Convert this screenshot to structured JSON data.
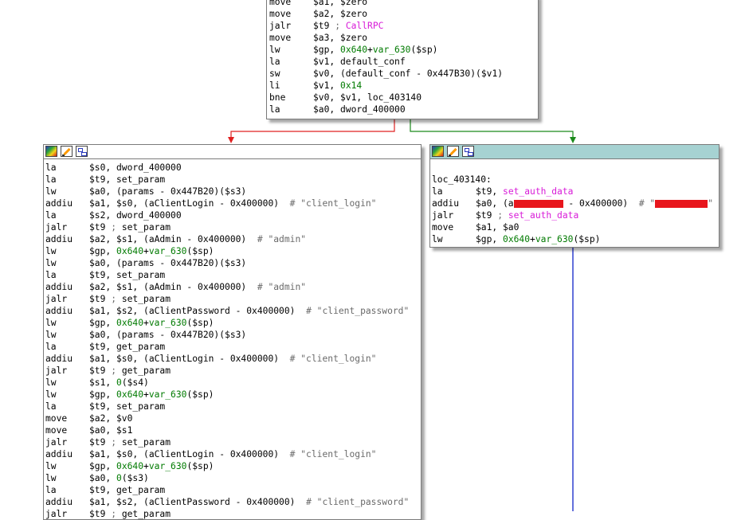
{
  "top_block": {
    "lines": [
      {
        "mn": "move",
        "ops": [
          {
            "t": "$a1, $zero"
          }
        ]
      },
      {
        "mn": "move",
        "ops": [
          {
            "t": "$a2, $zero"
          }
        ]
      },
      {
        "mn": "jalr",
        "ops": [
          {
            "t": "$t9 "
          },
          {
            "t": "; ",
            "c": "gray"
          },
          {
            "t": "CallRPC",
            "c": "pink"
          }
        ]
      },
      {
        "mn": "move",
        "ops": [
          {
            "t": "$a3, $zero"
          }
        ]
      },
      {
        "mn": "lw",
        "ops": [
          {
            "t": "$gp, "
          },
          {
            "t": "0x640",
            "c": "green"
          },
          {
            "t": "+"
          },
          {
            "t": "var_630",
            "c": "green"
          },
          {
            "t": "($sp)"
          }
        ]
      },
      {
        "mn": "la",
        "ops": [
          {
            "t": "$v1, default_conf"
          }
        ]
      },
      {
        "mn": "sw",
        "ops": [
          {
            "t": "$v0, (default_conf - 0x447B30)($v1)"
          }
        ]
      },
      {
        "mn": "li",
        "ops": [
          {
            "t": "$v1, "
          },
          {
            "t": "0x14",
            "c": "green"
          }
        ]
      },
      {
        "mn": "bne",
        "ops": [
          {
            "t": "$v0, $v1, loc_403140"
          }
        ]
      },
      {
        "mn": "la",
        "ops": [
          {
            "t": "$a0, dword_400000"
          }
        ]
      }
    ]
  },
  "left_block": {
    "lines": [
      {
        "mn": "la",
        "ops": [
          {
            "t": "$s0, dword_400000"
          }
        ]
      },
      {
        "mn": "la",
        "ops": [
          {
            "t": "$t9, set_param"
          }
        ]
      },
      {
        "mn": "lw",
        "ops": [
          {
            "t": "$a0, (params - 0x447B20)($s3)"
          }
        ]
      },
      {
        "mn": "addiu",
        "ops": [
          {
            "t": "$a1, $s0, (aClientLogin - 0x400000)  "
          },
          {
            "t": "# \"client_login\"",
            "c": "gray"
          }
        ]
      },
      {
        "mn": "la",
        "ops": [
          {
            "t": "$s2, dword_400000"
          }
        ]
      },
      {
        "mn": "jalr",
        "ops": [
          {
            "t": "$t9 "
          },
          {
            "t": "; ",
            "c": "gray"
          },
          {
            "t": "set_param"
          }
        ]
      },
      {
        "mn": "addiu",
        "ops": [
          {
            "t": "$a2, $s1, (aAdmin - 0x400000)  "
          },
          {
            "t": "# \"admin\"",
            "c": "gray"
          }
        ]
      },
      {
        "mn": "lw",
        "ops": [
          {
            "t": "$gp, "
          },
          {
            "t": "0x640",
            "c": "green"
          },
          {
            "t": "+"
          },
          {
            "t": "var_630",
            "c": "green"
          },
          {
            "t": "($sp)"
          }
        ]
      },
      {
        "mn": "lw",
        "ops": [
          {
            "t": "$a0, (params - 0x447B20)($s3)"
          }
        ]
      },
      {
        "mn": "la",
        "ops": [
          {
            "t": "$t9, set_param"
          }
        ]
      },
      {
        "mn": "addiu",
        "ops": [
          {
            "t": "$a2, $s1, (aAdmin - 0x400000)  "
          },
          {
            "t": "# \"admin\"",
            "c": "gray"
          }
        ]
      },
      {
        "mn": "jalr",
        "ops": [
          {
            "t": "$t9 "
          },
          {
            "t": "; ",
            "c": "gray"
          },
          {
            "t": "set_param"
          }
        ]
      },
      {
        "mn": "addiu",
        "ops": [
          {
            "t": "$a1, $s2, (aClientPassword - 0x400000)  "
          },
          {
            "t": "# \"client_password\"",
            "c": "gray"
          }
        ]
      },
      {
        "mn": "lw",
        "ops": [
          {
            "t": "$gp, "
          },
          {
            "t": "0x640",
            "c": "green"
          },
          {
            "t": "+"
          },
          {
            "t": "var_630",
            "c": "green"
          },
          {
            "t": "($sp)"
          }
        ]
      },
      {
        "mn": "lw",
        "ops": [
          {
            "t": "$a0, (params - 0x447B20)($s3)"
          }
        ]
      },
      {
        "mn": "la",
        "ops": [
          {
            "t": "$t9, get_param"
          }
        ]
      },
      {
        "mn": "addiu",
        "ops": [
          {
            "t": "$a1, $s0, (aClientLogin - 0x400000)  "
          },
          {
            "t": "# \"client_login\"",
            "c": "gray"
          }
        ]
      },
      {
        "mn": "jalr",
        "ops": [
          {
            "t": "$t9 "
          },
          {
            "t": "; ",
            "c": "gray"
          },
          {
            "t": "get_param"
          }
        ]
      },
      {
        "mn": "lw",
        "ops": [
          {
            "t": "$s1, "
          },
          {
            "t": "0",
            "c": "green"
          },
          {
            "t": "($s4)"
          }
        ]
      },
      {
        "mn": "lw",
        "ops": [
          {
            "t": "$gp, "
          },
          {
            "t": "0x640",
            "c": "green"
          },
          {
            "t": "+"
          },
          {
            "t": "var_630",
            "c": "green"
          },
          {
            "t": "($sp)"
          }
        ]
      },
      {
        "mn": "la",
        "ops": [
          {
            "t": "$t9, set_param"
          }
        ]
      },
      {
        "mn": "move",
        "ops": [
          {
            "t": "$a2, $v0"
          }
        ]
      },
      {
        "mn": "move",
        "ops": [
          {
            "t": "$a0, $s1"
          }
        ]
      },
      {
        "mn": "jalr",
        "ops": [
          {
            "t": "$t9 "
          },
          {
            "t": "; ",
            "c": "gray"
          },
          {
            "t": "set_param"
          }
        ]
      },
      {
        "mn": "addiu",
        "ops": [
          {
            "t": "$a1, $s0, (aClientLogin - 0x400000)  "
          },
          {
            "t": "# \"client_login\"",
            "c": "gray"
          }
        ]
      },
      {
        "mn": "lw",
        "ops": [
          {
            "t": "$gp, "
          },
          {
            "t": "0x640",
            "c": "green"
          },
          {
            "t": "+"
          },
          {
            "t": "var_630",
            "c": "green"
          },
          {
            "t": "($sp)"
          }
        ]
      },
      {
        "mn": "lw",
        "ops": [
          {
            "t": "$a0, "
          },
          {
            "t": "0",
            "c": "green"
          },
          {
            "t": "($s3)"
          }
        ]
      },
      {
        "mn": "la",
        "ops": [
          {
            "t": "$t9, get_param"
          }
        ]
      },
      {
        "mn": "addiu",
        "ops": [
          {
            "t": "$a1, $s2, (aClientPassword - 0x400000)  "
          },
          {
            "t": "# \"client_password\"",
            "c": "gray"
          }
        ]
      },
      {
        "mn": "jalr",
        "ops": [
          {
            "t": "$t9 "
          },
          {
            "t": "; ",
            "c": "gray"
          },
          {
            "t": "get_param"
          }
        ]
      }
    ]
  },
  "right_block": {
    "label": "loc_403140:",
    "lines": [
      {
        "mn": "la",
        "ops": [
          {
            "t": "$t9, "
          },
          {
            "t": "set_auth_data",
            "c": "pink"
          }
        ]
      },
      {
        "mn": "addiu",
        "ops": [
          {
            "t": "$a0, (a"
          },
          {
            "t": "",
            "redact": 62
          },
          {
            "t": " - 0x400000)  "
          },
          {
            "t": "# \"",
            "c": "gray"
          },
          {
            "t": "",
            "redact": 66
          },
          {
            "t": "\"",
            "c": "gray"
          }
        ]
      },
      {
        "mn": "jalr",
        "ops": [
          {
            "t": "$t9 "
          },
          {
            "t": "; ",
            "c": "gray"
          },
          {
            "t": "set_auth_data",
            "c": "pink"
          }
        ]
      },
      {
        "mn": "move",
        "ops": [
          {
            "t": "$a1, $a0"
          }
        ]
      },
      {
        "mn": "lw",
        "ops": [
          {
            "t": "$gp, "
          },
          {
            "t": "0x640",
            "c": "green"
          },
          {
            "t": "+"
          },
          {
            "t": "var_630",
            "c": "green"
          },
          {
            "t": "($sp)"
          }
        ]
      }
    ]
  },
  "colors": {
    "false_edge": "#e02020",
    "true_edge": "#1a8a1a",
    "down_edge": "#2233cc",
    "selected_titlebar": "#a6d2d2"
  },
  "icons": [
    "color-palette-icon",
    "rename-pencil-icon",
    "graph-overview-icon"
  ]
}
